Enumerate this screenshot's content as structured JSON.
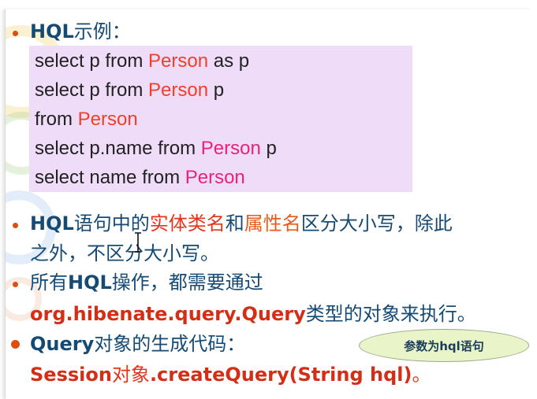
{
  "slide": {
    "heading": {
      "prefix": "HQL",
      "suffix": "示例："
    },
    "code_examples": [
      {
        "pre": "select p from ",
        "entity": "Person",
        "post": " as p"
      },
      {
        "pre": "select p from ",
        "entity": "Person",
        "post": " p"
      },
      {
        "pre": "from ",
        "entity": "Person",
        "post": ""
      },
      {
        "pre": "select p.name from ",
        "entity": "Person",
        "post": " p"
      },
      {
        "pre": "select name from ",
        "entity": "Person",
        "post": ""
      }
    ],
    "bullet2": {
      "part1": "HQL",
      "part2": "语句中的",
      "part3": "实体类名",
      "part4": "和",
      "part5": "属性名",
      "part6": "区分大小写，除此",
      "line2": "之外，不区分大小写。"
    },
    "bullet3": {
      "part1": "所有",
      "part2": "HQL",
      "part3": "操作，都需要通过",
      "line2_code": "org.hibenate.query.Query",
      "line2_text": "类型的对象来执行。"
    },
    "bullet4": {
      "part1": "Query",
      "part2": "对象的生成代码：",
      "line2_code1": "Session",
      "line2_text1": "对象",
      "line2_code2": ".createQuery(String hql)",
      "line2_text2": "。"
    },
    "callout": "参数为hql语句"
  },
  "colors": {
    "accent": "#e6341b",
    "text": "#154a74",
    "code_bg": "#efdcf8",
    "callout_bg": "#e9f5c8"
  },
  "icons": {
    "bullet": "bullet-dot-icon",
    "cursor": "text-cursor-icon"
  }
}
